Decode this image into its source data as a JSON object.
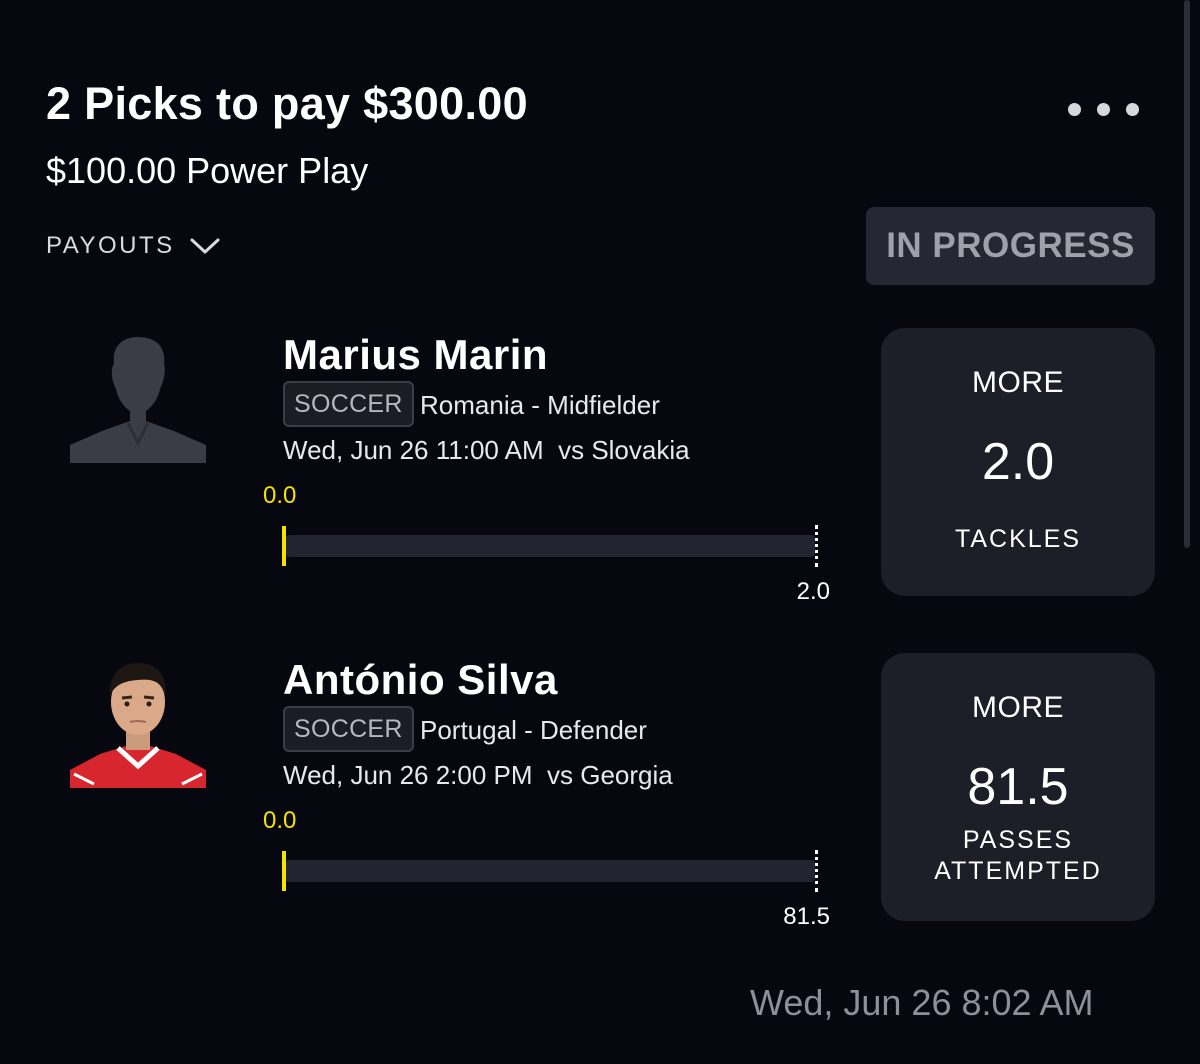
{
  "header": {
    "title": "2 Picks to pay $300.00",
    "subtitle": "$100.00 Power Play",
    "more_icon": "more-horizontal-icon"
  },
  "payouts": {
    "label": "PAYOUTS",
    "icon": "chevron-down-icon"
  },
  "status": {
    "label": "IN PROGRESS"
  },
  "picks": [
    {
      "player": "Marius Marin",
      "sport": "SOCCER",
      "team_position": "Romania - Midfielder",
      "game": "Wed, Jun 26 11:00 AM  vs Slovakia",
      "current": "0.0",
      "target": "2.0",
      "progress": 0,
      "direction": "MORE",
      "line": "2.0",
      "stat": "TACKLES",
      "avatar": "placeholder-silhouette"
    },
    {
      "player": "António Silva",
      "sport": "SOCCER",
      "team_position": "Portugal - Defender",
      "game": "Wed, Jun 26 2:00 PM  vs Georgia",
      "current": "0.0",
      "target": "81.5",
      "progress": 0,
      "direction": "MORE",
      "line": "81.5",
      "stat_line1": "PASSES",
      "stat_line2": "ATTEMPTED",
      "avatar": "player-photo"
    }
  ],
  "footer": {
    "timestamp": "Wed, Jun 26 8:02 AM"
  },
  "colors": {
    "accent_yellow": "#f2e300",
    "background": "#07080f",
    "card": "#1c1e28"
  }
}
